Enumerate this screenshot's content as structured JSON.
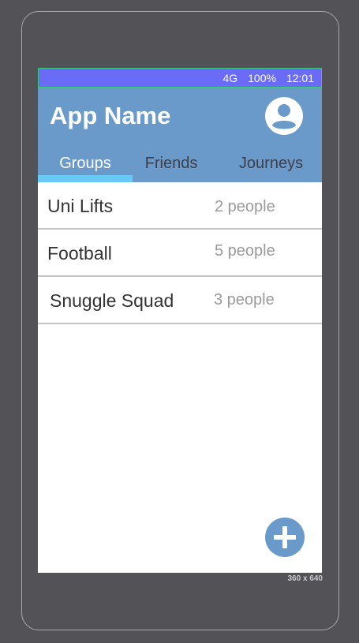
{
  "status_bar": {
    "network": "4G",
    "battery": "100%",
    "time": "12:01"
  },
  "header": {
    "title": "App Name",
    "profile_icon": "account-circle-icon"
  },
  "tabs": [
    {
      "label": "Groups",
      "active": true
    },
    {
      "label": "Friends",
      "active": false
    },
    {
      "label": "Journeys",
      "active": false
    }
  ],
  "groups": [
    {
      "name": "Uni Lifts",
      "count": "2 people"
    },
    {
      "name": "Football",
      "count": "5 people"
    },
    {
      "name": "Snuggle Squad",
      "count": "3 people"
    }
  ],
  "fab": {
    "icon": "plus-icon"
  },
  "frame": {
    "size_label": "360 x 640"
  },
  "colors": {
    "background": "#535257",
    "status_bar": "#6a6bf6",
    "app_bar": "#6a9ac9",
    "tab_indicator": "#66c9f6",
    "fab": "#6a9ac9"
  }
}
